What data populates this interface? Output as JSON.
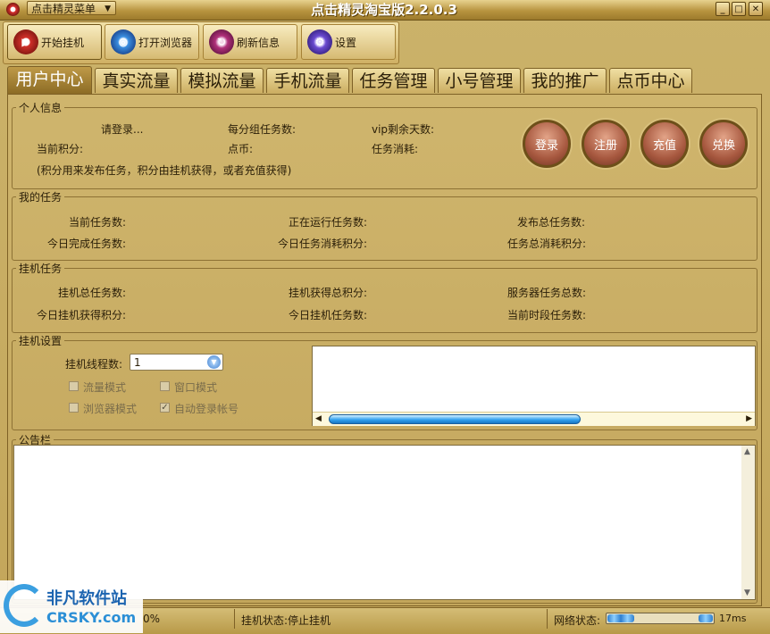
{
  "titlebar": {
    "menu_label": "点击精灵菜单",
    "title": "点击精灵淘宝版2.2.0.3"
  },
  "toolbar": {
    "start": "开始挂机",
    "browser": "打开浏览器",
    "refresh": "刷新信息",
    "settings": "设置"
  },
  "tabs": [
    "用户中心",
    "真实流量",
    "模拟流量",
    "手机流量",
    "任务管理",
    "小号管理",
    "我的推广",
    "点币中心"
  ],
  "personal": {
    "legend": "个人信息",
    "login_prompt": "请登录...",
    "per_group_tasks": "每分组任务数:",
    "vip_days": "vip剩余天数:",
    "current_points": "当前积分:",
    "coins": "点币:",
    "task_cost": "任务消耗:",
    "note": "(积分用来发布任务，积分由挂机获得，或者充值获得)",
    "buttons": {
      "login": "登录",
      "register": "注册",
      "recharge": "充值",
      "exchange": "兑换"
    }
  },
  "mytasks": {
    "legend": "我的任务",
    "current": "当前任务数:",
    "running": "正在运行任务数:",
    "published_total": "发布总任务数:",
    "today_done": "今日完成任务数:",
    "today_cost": "今日任务消耗积分:",
    "total_cost": "任务总消耗积分:"
  },
  "hang": {
    "legend": "挂机任务",
    "total_tasks": "挂机总任务数:",
    "total_points": "挂机获得总积分:",
    "server_total": "服务器任务总数:",
    "today_points": "今日挂机获得积分:",
    "today_tasks": "今日挂机任务数:",
    "period_tasks": "当前时段任务数:"
  },
  "hang_settings": {
    "legend": "挂机设置",
    "threads_label": "挂机线程数:",
    "threads_value": "1",
    "options": {
      "traffic_mode": "流量模式",
      "window_mode": "窗口模式",
      "browser_mode": "浏览器模式",
      "auto_login": "自动登录帐号"
    },
    "auto_login_checked": true
  },
  "notice": {
    "legend": "公告栏"
  },
  "status": {
    "percent": "0%",
    "hang_status": "挂机状态:停止挂机",
    "network": "网络状态:",
    "latency": "17ms"
  },
  "watermark": {
    "cn": "非凡软件站",
    "en": "CRSKY.com"
  },
  "colors": {
    "accent": "#8a6a24",
    "panel": "#c6a95f"
  }
}
